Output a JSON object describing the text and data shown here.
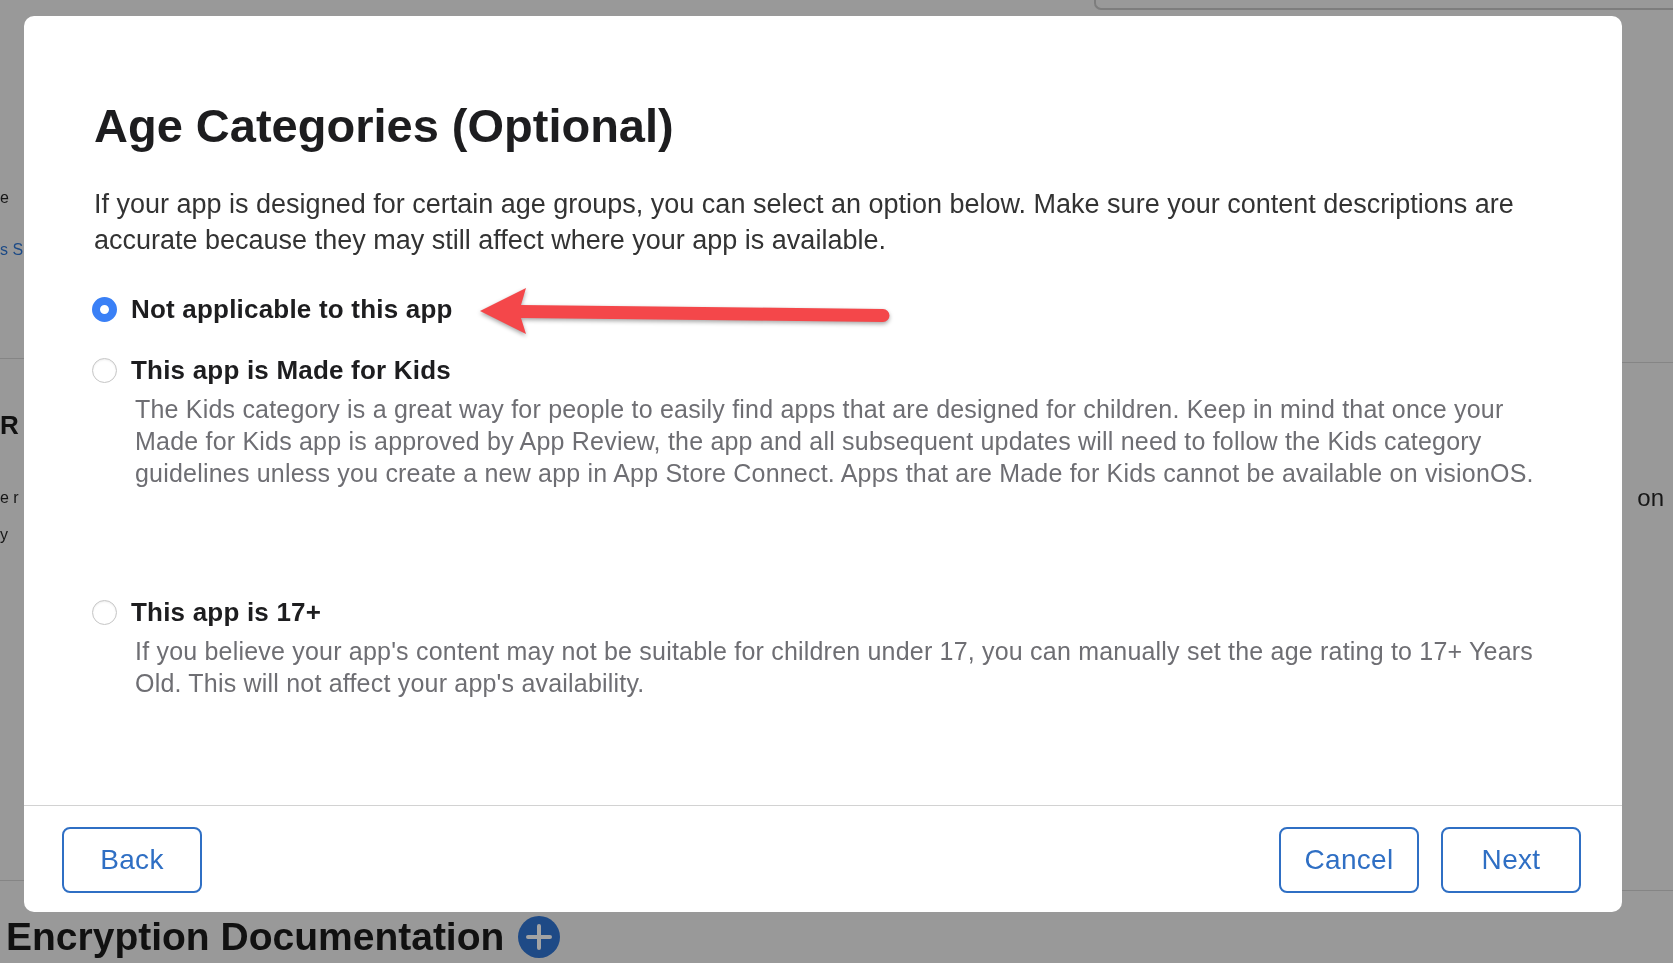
{
  "background_page": {
    "left_fragments": [
      {
        "text": "e",
        "kind": "text"
      },
      {
        "text": "s S",
        "kind": "link"
      },
      {
        "text": "R",
        "kind": "heading"
      },
      {
        "text": "e r",
        "kind": "text"
      },
      {
        "text": "y",
        "kind": "text"
      }
    ],
    "right_fragments": [
      {
        "text": "on",
        "kind": "text"
      }
    ],
    "section_heading": "Encryption Documentation"
  },
  "dialog": {
    "title": "Age Categories (Optional)",
    "description": "If your app is designed for certain age groups, you can select an option below. Make sure your content descriptions are accurate because they may still affect where your app is available.",
    "options": [
      {
        "label": "Not applicable to this app",
        "selected": true
      },
      {
        "label": "This app is Made for Kids",
        "selected": false,
        "description": "The Kids category is a great way for people to easily find apps that are designed for children. Keep in mind that once your Made for Kids app is approved by App Review, the app and all subsequent updates will need to follow the Kids category guidelines unless you create a new app in App Store Connect. Apps that are Made for Kids cannot be available on visionOS."
      },
      {
        "label": "This app is 17+",
        "selected": false,
        "description": "If you believe your app's content may not be suitable for children under 17, you can manually set the age rating to 17+ Years Old. This will not affect your app's availability."
      }
    ],
    "buttons_left": [
      "Back"
    ],
    "buttons_right": [
      "Cancel",
      "Next"
    ]
  }
}
